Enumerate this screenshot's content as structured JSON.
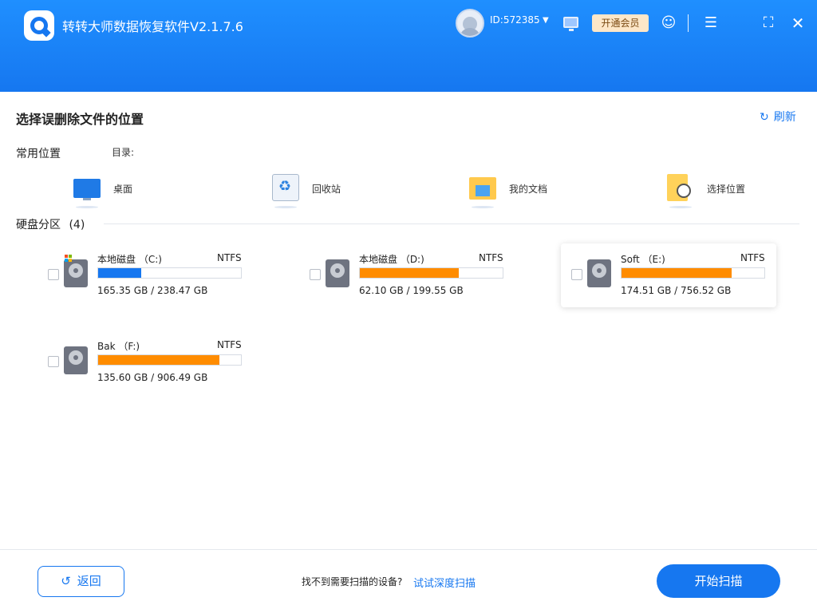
{
  "header": {
    "app_title": "转转大师数据恢复软件V2.1.7.6",
    "user_id": "ID:572385",
    "vip_label": "开通会员"
  },
  "main": {
    "page_title": "选择误删除文件的位置",
    "refresh_label": "刷新",
    "common_label": "常用位置",
    "dir_label": "目录:",
    "locations": [
      {
        "label": "桌面",
        "icon": "desktop-icon"
      },
      {
        "label": "回收站",
        "icon": "recycle-bin-icon"
      },
      {
        "label": "我的文档",
        "icon": "documents-folder-icon"
      },
      {
        "label": "选择位置",
        "icon": "select-location-icon"
      }
    ],
    "partition_title": "硬盘分区",
    "partition_count": "(4)"
  },
  "drives": [
    {
      "name": "本地磁盘 （C:)",
      "fs": "NTFS",
      "size": "165.35 GB / 238.47 GB",
      "used_fraction": 0.3,
      "bar_color": "#1677f0",
      "selected": false
    },
    {
      "name": "本地磁盘 （D:)",
      "fs": "NTFS",
      "size": "62.10 GB / 199.55 GB",
      "used_fraction": 0.69,
      "bar_color": "#ff8c00",
      "selected": false
    },
    {
      "name": "Soft （E:)",
      "fs": "NTFS",
      "size": "174.51 GB / 756.52 GB",
      "used_fraction": 0.77,
      "bar_color": "#ff8c00",
      "selected": true
    },
    {
      "name": "Bak （F:)",
      "fs": "NTFS",
      "size": "135.60 GB / 906.49 GB",
      "used_fraction": 0.85,
      "bar_color": "#ff8c00",
      "selected": false
    }
  ],
  "footer": {
    "back_label": "返回",
    "hint_text": "找不到需要扫描的设备?",
    "deep_scan_label": "试试深度扫描",
    "start_label": "开始扫描"
  },
  "colors": {
    "accent": "#1677f0",
    "usage_orange": "#ff8c00"
  }
}
